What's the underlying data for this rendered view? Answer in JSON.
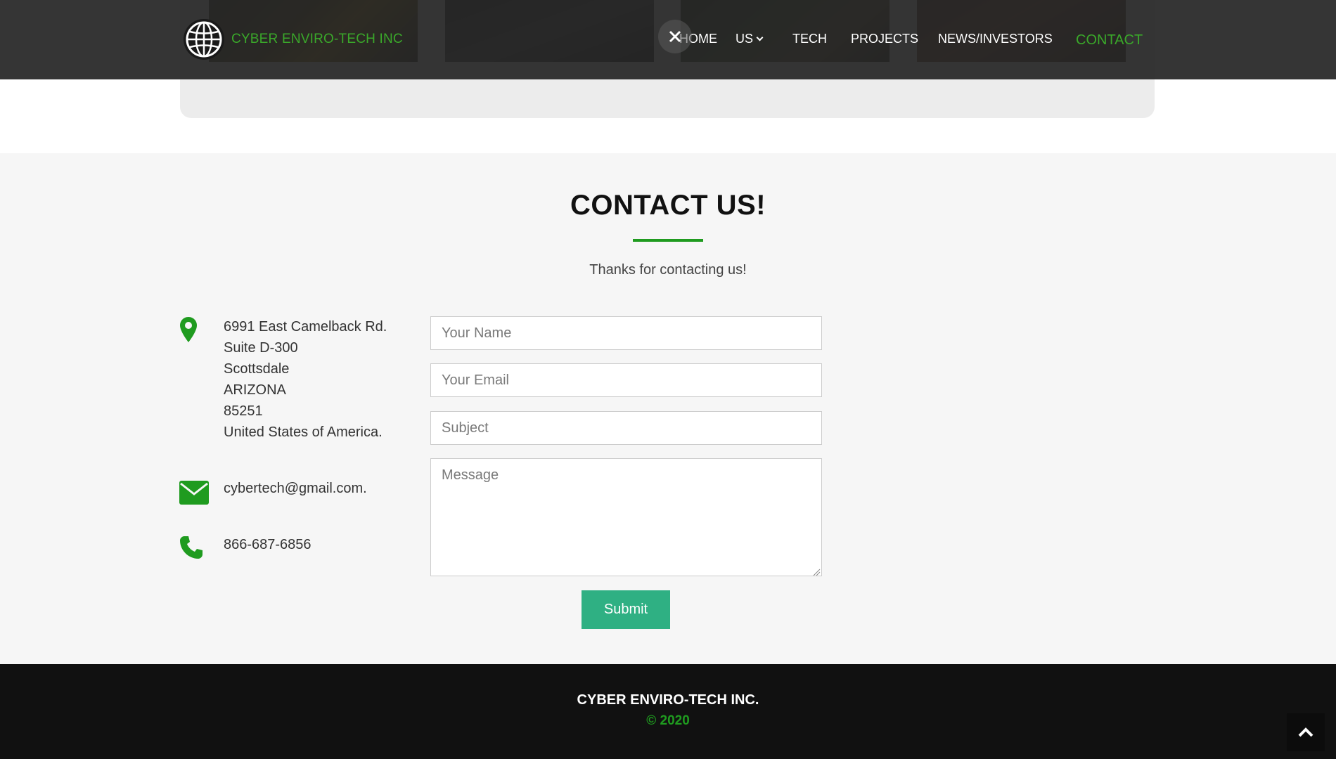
{
  "brand": {
    "name": "CYBER ENVIRO-TECH INC"
  },
  "nav": {
    "items": [
      {
        "label": "HOME"
      },
      {
        "label": "US"
      },
      {
        "label": "TECH"
      },
      {
        "label": "PROJECTS"
      },
      {
        "label": "NEWS/INVESTORS"
      },
      {
        "label": "CONTACT"
      }
    ],
    "active": "CONTACT"
  },
  "contact": {
    "title": "CONTACT US!",
    "subtitle": "Thanks for contacting us!",
    "address_lines": [
      "6991 East Camelback Rd.",
      "Suite D-300",
      "Scottsdale",
      "ARIZONA",
      "85251",
      "United States of America."
    ],
    "email": "cybertech@gmail.com.",
    "phone": "866-687-6856"
  },
  "form": {
    "name_placeholder": "Your Name",
    "email_placeholder": "Your Email",
    "subject_placeholder": "Subject",
    "message_placeholder": "Message",
    "submit_label": "Submit"
  },
  "footer": {
    "company": "CYBER ENVIRO-TECH INC.",
    "copyright": "© 2020"
  },
  "colors": {
    "accent_green": "#1f9b1f",
    "brand_green": "#3aa82a",
    "submit_teal": "#2fb083",
    "header_bg": "#262626",
    "footer_bg": "#111111"
  }
}
